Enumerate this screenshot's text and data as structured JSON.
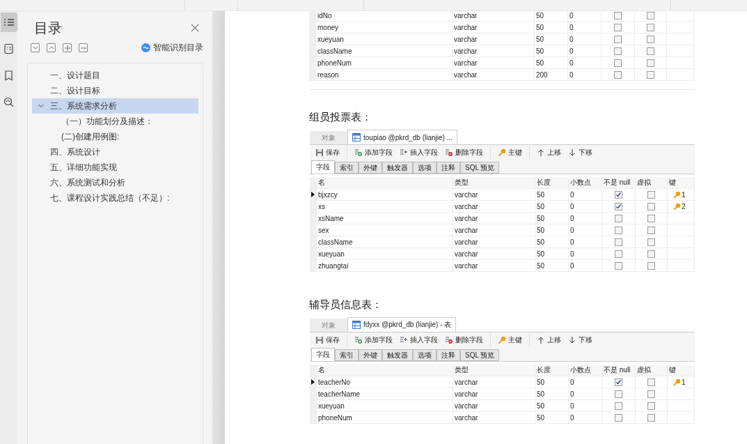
{
  "rail": [
    {
      "kind": "toc",
      "selected": true
    },
    {
      "kind": "list",
      "selected": false
    },
    {
      "kind": "bookmark",
      "selected": false
    },
    {
      "kind": "find",
      "selected": false
    }
  ],
  "sidebar": {
    "title": "目录",
    "smart_button": "智能识别目录",
    "items": [
      {
        "label": "一、设计题目",
        "selected": false
      },
      {
        "label": "二、设计目标",
        "selected": false
      },
      {
        "label": "三、系统需求分析",
        "selected": true,
        "expanded": true,
        "children": [
          {
            "label": "（一）功能划分及描述：",
            "selected": false
          },
          {
            "label": "(二)创建用例图:",
            "selected": false
          }
        ]
      },
      {
        "label": "四、系统设计",
        "selected": false
      },
      {
        "label": "五、详细功能实现",
        "selected": false
      },
      {
        "label": "六、系统测试和分析",
        "selected": false
      },
      {
        "label": "七、课程设计实践总结（不足）:",
        "selected": false
      }
    ]
  },
  "document": {
    "top_table_rows": [
      {
        "name": "idNo",
        "type": "varchar",
        "length": "50",
        "decimals": "0",
        "not_null": false,
        "virtual": false,
        "current": false
      },
      {
        "name": "money",
        "type": "varchar",
        "length": "50",
        "decimals": "0",
        "not_null": false,
        "virtual": false,
        "current": false
      },
      {
        "name": "xueyuan",
        "type": "varchar",
        "length": "50",
        "decimals": "0",
        "not_null": false,
        "virtual": false,
        "current": false
      },
      {
        "name": "className",
        "type": "varchar",
        "length": "50",
        "decimals": "0",
        "not_null": false,
        "virtual": false,
        "current": false
      },
      {
        "name": "phoneNum",
        "type": "varchar",
        "length": "50",
        "decimals": "0",
        "not_null": false,
        "virtual": false,
        "current": false
      },
      {
        "name": "reason",
        "type": "varchar",
        "length": "200",
        "decimals": "0",
        "not_null": false,
        "virtual": false,
        "current": false
      }
    ],
    "sections": [
      {
        "heading": "组员投票表：",
        "screenshot": {
          "object_tab": "对象",
          "tab": "toupiao @pkrd_db (lianjie) ...",
          "toolbar": [
            {
              "kind": "save",
              "label": "保存"
            },
            {
              "kind": "add",
              "label": "添加字段"
            },
            {
              "kind": "insert",
              "label": "插入字段"
            },
            {
              "kind": "delete",
              "label": "删除字段"
            },
            {
              "kind": "key",
              "label": "主键"
            },
            {
              "kind": "up",
              "label": "上移"
            },
            {
              "kind": "down",
              "label": "下移"
            }
          ],
          "subtabs": [
            {
              "label": "字段",
              "selected": true
            },
            {
              "label": "索引",
              "selected": false
            },
            {
              "label": "外键",
              "selected": false
            },
            {
              "label": "触发器",
              "selected": false
            },
            {
              "label": "选项",
              "selected": false
            },
            {
              "label": "注释",
              "selected": false
            },
            {
              "label": "SQL 预览",
              "selected": false
            }
          ],
          "columns": [
            "名",
            "类型",
            "长度",
            "小数点",
            "不是 null",
            "虚拟",
            "键"
          ],
          "rows": [
            {
              "name": "bjxzcy",
              "type": "varchar",
              "length": "50",
              "decimals": "0",
              "not_null": true,
              "virtual": false,
              "key": "1",
              "current": true
            },
            {
              "name": "xs",
              "type": "varchar",
              "length": "50",
              "decimals": "0",
              "not_null": true,
              "virtual": false,
              "key": "2",
              "current": false
            },
            {
              "name": "xsName",
              "type": "varchar",
              "length": "50",
              "decimals": "0",
              "not_null": false,
              "virtual": false,
              "current": false
            },
            {
              "name": "sex",
              "type": "varchar",
              "length": "50",
              "decimals": "0",
              "not_null": false,
              "virtual": false,
              "current": false
            },
            {
              "name": "className",
              "type": "varchar",
              "length": "50",
              "decimals": "0",
              "not_null": false,
              "virtual": false,
              "current": false
            },
            {
              "name": "xueyuan",
              "type": "varchar",
              "length": "50",
              "decimals": "0",
              "not_null": false,
              "virtual": false,
              "current": false
            },
            {
              "name": "zhuangtai",
              "type": "varchar",
              "length": "50",
              "decimals": "0",
              "not_null": false,
              "virtual": false,
              "current": false
            }
          ]
        }
      },
      {
        "heading": "辅导员信息表：",
        "screenshot": {
          "object_tab": "对象",
          "tab": "fdyxx @pkrd_db (lianjie) - 表",
          "toolbar": [
            {
              "kind": "save",
              "label": "保存"
            },
            {
              "kind": "add",
              "label": "添加字段"
            },
            {
              "kind": "insert",
              "label": "插入字段"
            },
            {
              "kind": "delete",
              "label": "删除字段"
            },
            {
              "kind": "key",
              "label": "主键"
            },
            {
              "kind": "up",
              "label": "上移"
            },
            {
              "kind": "down",
              "label": "下移"
            }
          ],
          "subtabs": [
            {
              "label": "字段",
              "selected": true
            },
            {
              "label": "索引",
              "selected": false
            },
            {
              "label": "外键",
              "selected": false
            },
            {
              "label": "触发器",
              "selected": false
            },
            {
              "label": "选项",
              "selected": false
            },
            {
              "label": "注释",
              "selected": false
            },
            {
              "label": "SQL 预览",
              "selected": false
            }
          ],
          "columns": [
            "名",
            "类型",
            "长度",
            "小数点",
            "不是 null",
            "虚拟",
            "键"
          ],
          "rows": [
            {
              "name": "teacherNo",
              "type": "varchar",
              "length": "50",
              "decimals": "0",
              "not_null": true,
              "virtual": false,
              "key": "1",
              "current": true
            },
            {
              "name": "teacherName",
              "type": "varchar",
              "length": "50",
              "decimals": "0",
              "not_null": false,
              "virtual": false,
              "current": false
            },
            {
              "name": "xueyuan",
              "type": "varchar",
              "length": "50",
              "decimals": "0",
              "not_null": false,
              "virtual": false,
              "current": false
            },
            {
              "name": "phoneNum",
              "type": "varchar",
              "length": "50",
              "decimals": "0",
              "not_null": false,
              "virtual": false,
              "current": false
            }
          ]
        }
      }
    ]
  }
}
